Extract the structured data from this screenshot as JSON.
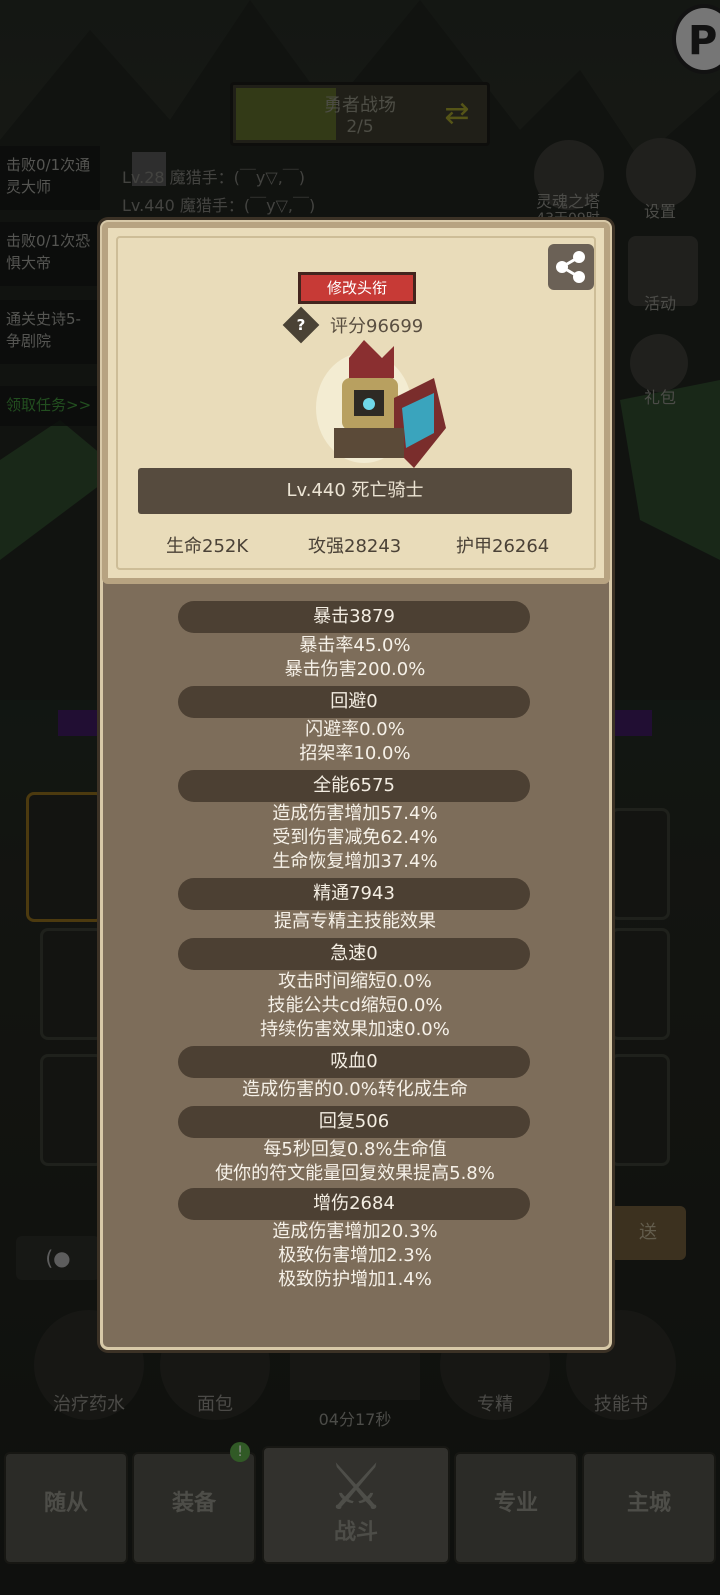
{
  "background": {
    "arena": {
      "title": "勇者战场",
      "progress": "2/5"
    },
    "quests": [
      {
        "line1": "击败0/1次通",
        "line2": "灵大师"
      },
      {
        "line1": "击败0/1次恐",
        "line2": "惧大帝"
      },
      {
        "line1": "通关史诗5-",
        "line2": "争剧院"
      }
    ],
    "quest_claim": "领取任务>>",
    "opponents": [
      "Lv.28 魔猎手：(￣y▽,￣)",
      "Lv.440 魔猎手：(￣y▽,￣)"
    ],
    "side_menu": {
      "soul_tower": "灵魂之塔",
      "soul_tower_sub": "43天09时",
      "settings": "设置",
      "activity": "活动",
      "gift": "礼包"
    },
    "resources": [
      {
        "label": "治疗药水"
      },
      {
        "label": "面包"
      },
      {
        "label": "专精"
      },
      {
        "label": "技能书"
      }
    ],
    "timer": "04分17秒",
    "send_btn": "送",
    "tabs": [
      "随从",
      "装备",
      "战斗",
      "专业",
      "主城"
    ],
    "badge_count": "!"
  },
  "profile": {
    "change_title_btn": "修改头衔",
    "score": "评分96699",
    "name_level": "Lv.440 死亡骑士",
    "hp": "生命252K",
    "attack": "攻强28243",
    "armor": "护甲26264"
  },
  "stats": {
    "crit": {
      "header": "暴击3879",
      "lines": [
        "暴击率45.0%",
        "暴击伤害200.0%"
      ]
    },
    "dodge": {
      "header": "回避0",
      "lines": [
        "闪避率0.0%",
        "招架率10.0%"
      ]
    },
    "versatility": {
      "header": "全能6575",
      "lines": [
        "造成伤害增加57.4%",
        "受到伤害减免62.4%",
        "生命恢复增加37.4%"
      ]
    },
    "mastery": {
      "header": "精通7943",
      "lines": [
        "提高专精主技能效果"
      ]
    },
    "haste": {
      "header": "急速0",
      "lines": [
        "攻击时间缩短0.0%",
        "技能公共cd缩短0.0%",
        "持续伤害效果加速0.0%"
      ]
    },
    "lifesteal": {
      "header": "吸血0",
      "lines": [
        "造成伤害的0.0%转化成生命"
      ]
    },
    "regen": {
      "header": "回复506",
      "lines": [
        "每5秒回复0.8%生命值",
        "使你的符文能量回复效果提高5.8%"
      ]
    },
    "damage_boost": {
      "header": "增伤2684",
      "lines": [
        "造成伤害增加20.3%",
        "极致伤害增加2.3%",
        "极致防护增加1.4%"
      ]
    }
  },
  "colors": {
    "title_button": "#c73a36",
    "panel": "#7d6d5a",
    "card": "#e9dcba",
    "header_pill": "#4c4033"
  }
}
